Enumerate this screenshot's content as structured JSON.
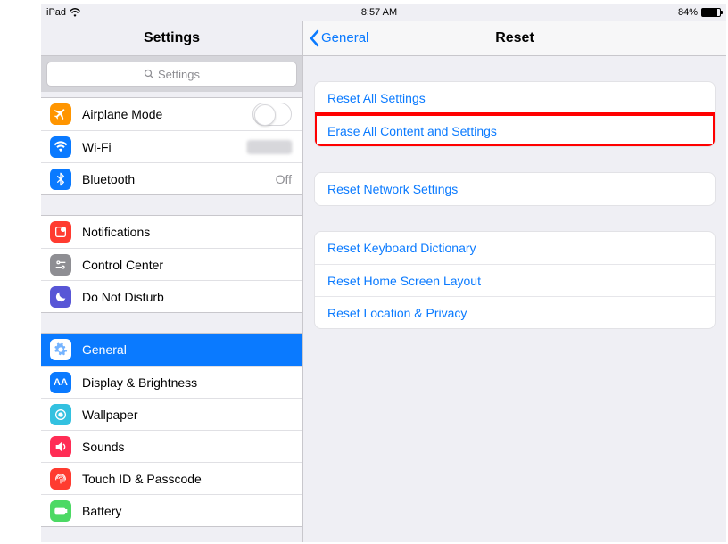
{
  "status": {
    "device": "iPad",
    "time": "8:57 AM",
    "battery_pct": "84%"
  },
  "sidebar": {
    "title": "Settings",
    "search_placeholder": "Settings",
    "groups": [
      {
        "items": [
          {
            "id": "airplane",
            "label": "Airplane Mode",
            "icon": "airplane-icon",
            "bg": "#ff9500",
            "tail": "toggle"
          },
          {
            "id": "wifi",
            "label": "Wi-Fi",
            "icon": "wifi-icon",
            "bg": "#0a7aff",
            "tail": "blur"
          },
          {
            "id": "bluetooth",
            "label": "Bluetooth",
            "icon": "bluetooth-icon",
            "bg": "#0a7aff",
            "tail": "Off"
          }
        ]
      },
      {
        "items": [
          {
            "id": "notifications",
            "label": "Notifications",
            "icon": "notifications-icon",
            "bg": "#ff3b30"
          },
          {
            "id": "controlcenter",
            "label": "Control Center",
            "icon": "control-center-icon",
            "bg": "#8e8e93"
          },
          {
            "id": "dnd",
            "label": "Do Not Disturb",
            "icon": "moon-icon",
            "bg": "#5856d6"
          }
        ]
      },
      {
        "items": [
          {
            "id": "general",
            "label": "General",
            "icon": "gear-icon",
            "bg": "#8e8e93",
            "selected": true
          },
          {
            "id": "display",
            "label": "Display & Brightness",
            "icon": "display-icon",
            "bg": "#0a7aff"
          },
          {
            "id": "wallpaper",
            "label": "Wallpaper",
            "icon": "wallpaper-icon",
            "bg": "#33c1e0"
          },
          {
            "id": "sounds",
            "label": "Sounds",
            "icon": "sounds-icon",
            "bg": "#ff2d55"
          },
          {
            "id": "touchid",
            "label": "Touch ID & Passcode",
            "icon": "fingerprint-icon",
            "bg": "#ff3b30"
          },
          {
            "id": "battery",
            "label": "Battery",
            "icon": "battery-icon",
            "bg": "#4cd964"
          }
        ]
      }
    ]
  },
  "detail": {
    "back_label": "General",
    "title": "Reset",
    "groups": [
      {
        "items": [
          {
            "id": "reset-all",
            "label": "Reset All Settings"
          },
          {
            "id": "erase-all",
            "label": "Erase All Content and Settings",
            "highlight": true
          }
        ]
      },
      {
        "items": [
          {
            "id": "reset-network",
            "label": "Reset Network Settings"
          }
        ]
      },
      {
        "items": [
          {
            "id": "reset-keyboard",
            "label": "Reset Keyboard Dictionary"
          },
          {
            "id": "reset-home",
            "label": "Reset Home Screen Layout"
          },
          {
            "id": "reset-location",
            "label": "Reset Location & Privacy"
          }
        ]
      }
    ]
  }
}
